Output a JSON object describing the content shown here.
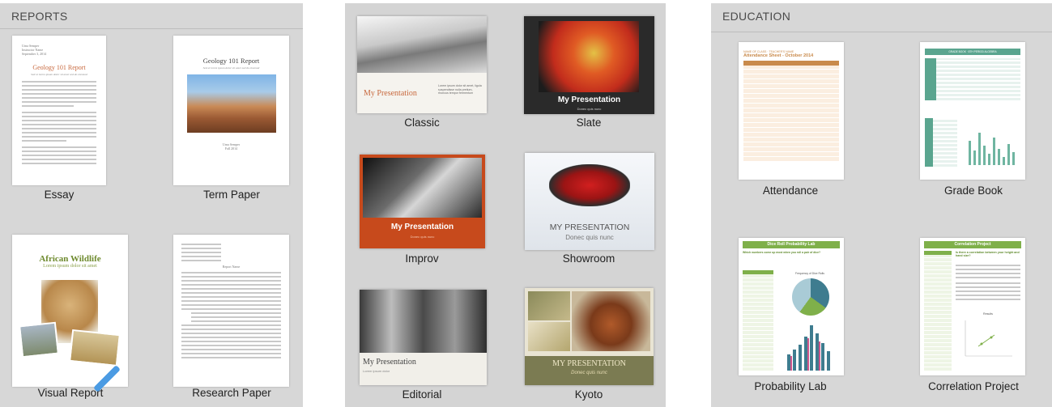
{
  "reports": {
    "section_title": "REPORTS",
    "templates": [
      {
        "caption": "Essay",
        "doc_title": "Geology 101 Report",
        "doc_subtitle": "Sed ut lorem ipsum dolor sit amet sed do eiusmod",
        "author_lines": [
          "Urna Semper",
          "Instructor Name",
          "September 3, 2014"
        ]
      },
      {
        "caption": "Term Paper",
        "doc_title": "Geology 101 Report",
        "doc_subtitle": "Sed ut lorem ipsum dolor sit amet sed do eiusmod",
        "author_lines": [
          "Urna Semper",
          "Fall 2014"
        ]
      },
      {
        "caption": "Visual Report",
        "doc_title": "African Wildlife",
        "doc_subtitle": "Lorem ipsum dolor sit amet"
      },
      {
        "caption": "Research Paper",
        "doc_heading": "Report Name"
      }
    ]
  },
  "themes": {
    "templates": [
      {
        "caption": "Classic",
        "slide_title": "My Presentation",
        "slide_text": "Lorem ipsum dolor sit amet, ligula suspendisse nulla pretium, rhoncus tempor fermentum"
      },
      {
        "caption": "Slate",
        "slide_title": "My Presentation",
        "slide_subtitle": "Donec quis nunc"
      },
      {
        "caption": "Improv",
        "slide_title": "My Presentation",
        "slide_subtitle": "Donec quis nunc"
      },
      {
        "caption": "Showroom",
        "slide_title": "MY PRESENTATION",
        "slide_subtitle": "Donec quis nunc"
      },
      {
        "caption": "Editorial",
        "slide_title": "My Presentation",
        "slide_subtitle": "Lorem ipsum dolor"
      },
      {
        "caption": "Kyoto",
        "slide_title": "MY PRESENTATION",
        "slide_subtitle": "Donec quis nunc"
      }
    ]
  },
  "education": {
    "section_title": "EDUCATION",
    "templates": [
      {
        "caption": "Attendance",
        "doc_title": "Attendance Sheet - October 2014",
        "doc_kicker": "NAME OF CLASS · TEACHER'S NAME"
      },
      {
        "caption": "Grade Book",
        "doc_title": "GRADE BOOK · 8TH PERIOD ALGEBRA"
      },
      {
        "caption": "Probability Lab",
        "doc_title": "Dice Roll Probability Lab",
        "doc_subtitle": "Which numbers come up most when you roll a pair of dice?",
        "chart_label": "Frequency of Dice Rolls"
      },
      {
        "caption": "Correlation Project",
        "doc_title": "Correlation Project",
        "doc_subtitle": "Is there a correlation between your height and hand size?",
        "chart_label": "Results"
      }
    ]
  },
  "colors": {
    "essay_title": "#c8693e",
    "visual_title": "#6e8a2e",
    "attendance_header": "#c98a4b",
    "gradebook_header": "#5aa58f",
    "lab_header": "#7fb04a",
    "improv_bar": "#c74a1c",
    "kyoto_bar": "#7b7b52"
  }
}
